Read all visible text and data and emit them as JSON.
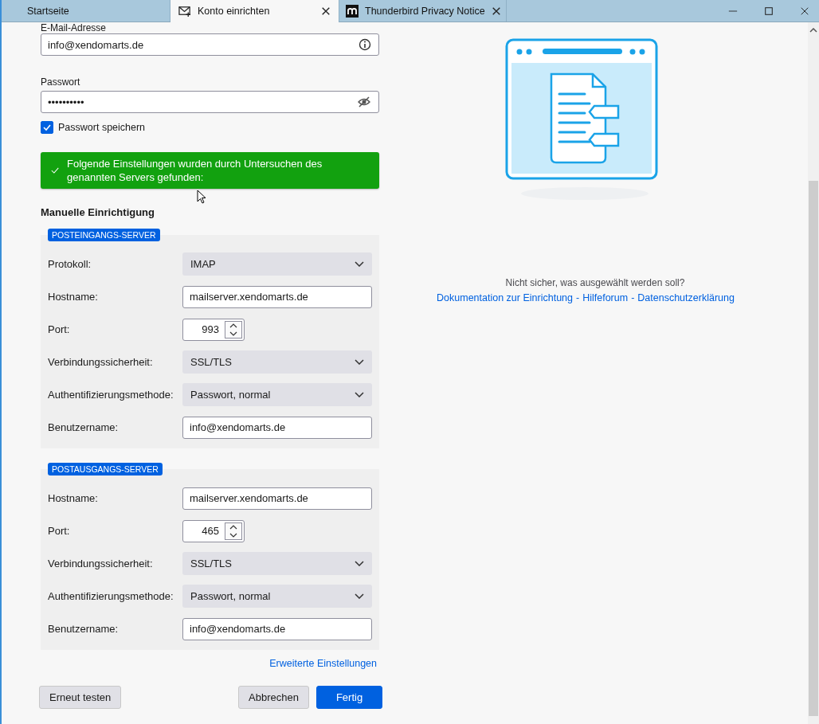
{
  "tabs": [
    {
      "label": "Startseite",
      "selected": false,
      "closable": false
    },
    {
      "label": "Konto einrichten",
      "selected": true,
      "closable": true
    },
    {
      "label": "Thunderbird Privacy Notice",
      "selected": false,
      "closable": true
    }
  ],
  "account": {
    "email_label": "E-Mail-Adresse",
    "email": "info@xendomarts.de",
    "password_label": "Passwort",
    "password": "••••••••••",
    "save_password": {
      "label": "Passwort speichern",
      "checked": true
    }
  },
  "banner": {
    "kind": "success",
    "text": "Folgende Einstellungen wurden durch Untersuchen des genannten Servers gefunden:"
  },
  "manual_heading": "Manuelle Einrichtigung",
  "servers": [
    {
      "title": "POSTEINGANGS-SERVER",
      "rows": [
        {
          "label": "Protokoll:",
          "kind": "select",
          "value": "IMAP"
        },
        {
          "label": "Hostname:",
          "kind": "text",
          "value": "mailserver.xendomarts.de"
        },
        {
          "label": "Port:",
          "kind": "number",
          "value": "993"
        },
        {
          "label": "Verbindungssicherheit:",
          "kind": "select",
          "value": "SSL/TLS"
        },
        {
          "label": "Authentifizierungsmethode:",
          "kind": "select",
          "value": "Passwort, normal"
        },
        {
          "label": "Benutzername:",
          "kind": "text",
          "value": "info@xendomarts.de"
        }
      ]
    },
    {
      "title": "POSTAUSGANGS-SERVER",
      "rows": [
        {
          "label": "Hostname:",
          "kind": "text",
          "value": "mailserver.xendomarts.de"
        },
        {
          "label": "Port:",
          "kind": "number",
          "value": "465"
        },
        {
          "label": "Verbindungssicherheit:",
          "kind": "select",
          "value": "SSL/TLS"
        },
        {
          "label": "Authentifizierungsmethode:",
          "kind": "select",
          "value": "Passwort, normal"
        },
        {
          "label": "Benutzername:",
          "kind": "text",
          "value": "info@xendomarts.de"
        }
      ]
    }
  ],
  "advanced_link": "Erweiterte Einstellungen",
  "buttons": [
    {
      "label": "Erneut testen",
      "kind": "secondary"
    },
    {
      "label": "Abbrechen",
      "kind": "secondary"
    },
    {
      "label": "Fertig",
      "kind": "primary"
    }
  ],
  "help": {
    "question": "Nicht sicher, was ausgewählt werden soll?",
    "separator": "-",
    "links": [
      "Dokumentation zur Einrichtung",
      "Hilfeforum",
      "Datenschutzerklärung"
    ]
  }
}
